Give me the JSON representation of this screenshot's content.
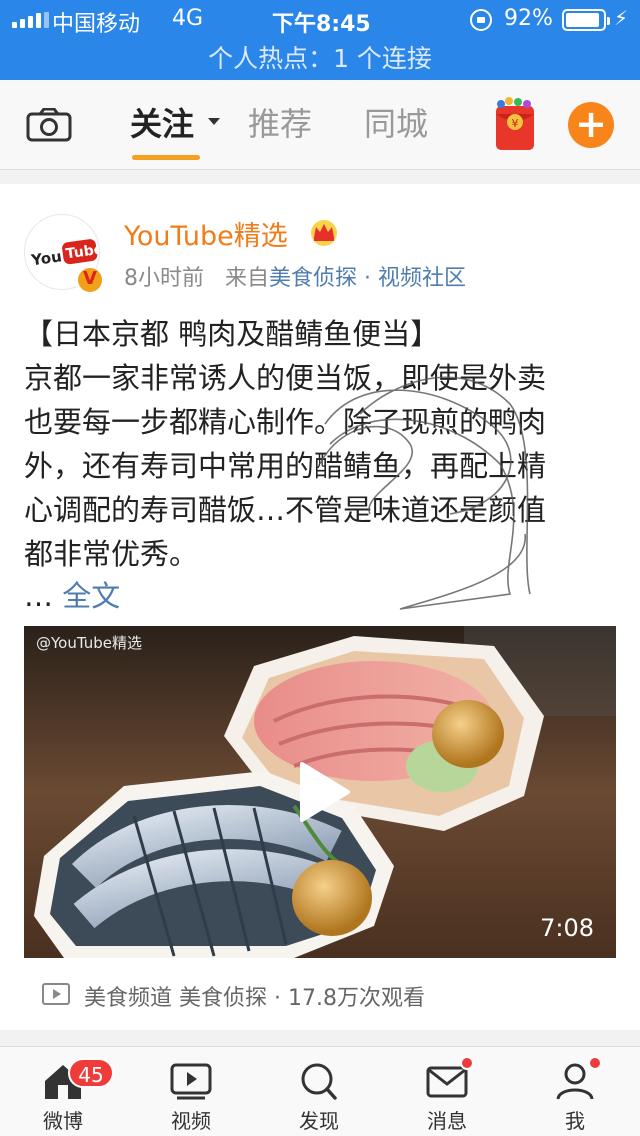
{
  "status_bar": {
    "carrier": "中国移动",
    "network": "4G",
    "time": "下午8:45",
    "battery_percent": "92%",
    "battery_level": 0.92,
    "hotspot": "个人热点：1 个连接"
  },
  "top_nav": {
    "tabs": [
      {
        "label": "关注",
        "active": true
      },
      {
        "label": "推荐",
        "active": false
      },
      {
        "label": "同城",
        "active": false
      }
    ],
    "icons": [
      "camera-icon",
      "red-packet-icon",
      "plus-icon"
    ],
    "accent_color": "#f7851a"
  },
  "post": {
    "author": "YouTube精选",
    "avatar_logo_text": "YouTube",
    "verified_badge": "V",
    "time": "8小时前",
    "from_prefix": "来自",
    "source": "美食侦探 · 视频社区",
    "lines": [
      "【日本京都 鸭肉及醋鲭鱼便当】",
      "京都一家非常诱人的便当饭，即使是外卖",
      "也要每一步都精心制作。除了现煎的鸭肉",
      "外，还有寿司中常用的醋鲭鱼，再配上精",
      "心调配的寿司醋饭…不管是味道还是颜值",
      "都非常优秀。"
    ],
    "ellipsis": "…",
    "full_text_link": "全文",
    "video": {
      "watermark": "@YouTube精选",
      "duration": "7:08"
    },
    "video_meta": "美食频道 美食侦探 · 17.8万次观看"
  },
  "tab_bar": {
    "items": [
      {
        "label": "微博",
        "icon": "home-icon",
        "badge": "45"
      },
      {
        "label": "视频",
        "icon": "video-icon"
      },
      {
        "label": "发现",
        "icon": "search-icon"
      },
      {
        "label": "消息",
        "icon": "mail-icon"
      },
      {
        "label": "我",
        "icon": "profile-icon"
      }
    ]
  }
}
